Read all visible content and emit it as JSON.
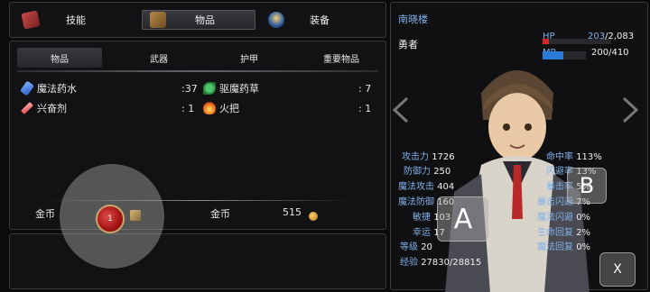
{
  "top_tabs": {
    "skill": "技能",
    "items": "物品",
    "equip": "装备"
  },
  "sub_tabs": [
    "物品",
    "武器",
    "护甲",
    "重要物品"
  ],
  "items": [
    {
      "name": "魔法药水",
      "qty": ":37",
      "icon": "potion-icon"
    },
    {
      "name": "驱魔药草",
      "qty": ":  7",
      "icon": "herb-icon"
    },
    {
      "name": "兴奋剂",
      "qty": ":  1",
      "icon": "stimulant-icon"
    },
    {
      "name": "火把",
      "qty": ":  1",
      "icon": "torch-icon"
    }
  ],
  "gold": {
    "left_label": "金币",
    "left_value": "1",
    "right_label": "金币",
    "right_value": "515"
  },
  "character": {
    "name": "南晓楼",
    "class": "勇者",
    "hp": {
      "label": "HP",
      "current": "203",
      "max": "/2,083",
      "fraction": 0.097,
      "color": "#d42828"
    },
    "mp": {
      "label": "MP",
      "value": "200/410",
      "fraction": 0.488,
      "color": "#2a7ad8"
    }
  },
  "stats_left": [
    {
      "k": "攻击力",
      "v": "1726"
    },
    {
      "k": "防御力",
      "v": "250"
    },
    {
      "k": "魔法攻击",
      "v": "404"
    },
    {
      "k": "魔法防御",
      "v": "160"
    },
    {
      "k": "敏捷",
      "v": "103"
    },
    {
      "k": "幸运",
      "v": "17"
    },
    {
      "k": "等级",
      "v": "20"
    },
    {
      "k": "经验",
      "v": "27830/28815"
    }
  ],
  "stats_right": [
    {
      "k": "命中率",
      "v": "113%"
    },
    {
      "k": "闪避率",
      "v": "13%"
    },
    {
      "k": "暴击率",
      "v": "5%"
    },
    {
      "k": "暴击闪避",
      "v": "7%"
    },
    {
      "k": "魔法闪避",
      "v": "0%"
    },
    {
      "k": "生命回复",
      "v": "2%"
    },
    {
      "k": "魔法回复",
      "v": "0%"
    }
  ],
  "buttons": {
    "a": "A",
    "b": "B",
    "x": "X"
  },
  "colors": {
    "accent": "#7fb0e8",
    "panel": "#121214",
    "border": "#3a3a3e"
  }
}
